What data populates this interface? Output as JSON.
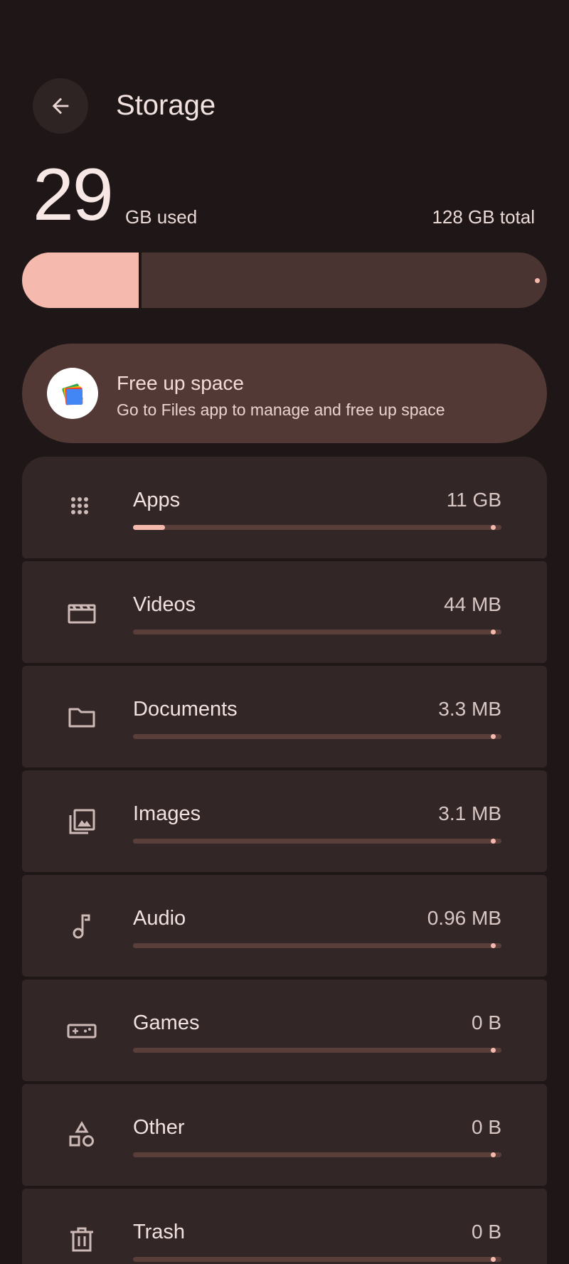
{
  "header": {
    "title": "Storage",
    "back_icon": "arrow-back-icon"
  },
  "usage": {
    "used_value": "29",
    "used_unit": "GB used",
    "total_label": "128 GB total",
    "used_fraction": 0.227
  },
  "free_up": {
    "title": "Free up space",
    "subtitle": "Go to Files app to manage and free up space",
    "icon": "files-app-icon"
  },
  "categories": [
    {
      "label": "Apps",
      "size": "11 GB",
      "icon": "apps-grid-icon",
      "fraction": 0.086
    },
    {
      "label": "Videos",
      "size": "44 MB",
      "icon": "movie-clapper-icon",
      "fraction": 0
    },
    {
      "label": "Documents",
      "size": "3.3 MB",
      "icon": "folder-icon",
      "fraction": 0
    },
    {
      "label": "Images",
      "size": "3.1 MB",
      "icon": "photo-library-icon",
      "fraction": 0
    },
    {
      "label": "Audio",
      "size": "0.96 MB",
      "icon": "music-note-icon",
      "fraction": 0
    },
    {
      "label": "Games",
      "size": "0 B",
      "icon": "gamepad-icon",
      "fraction": 0
    },
    {
      "label": "Other",
      "size": "0 B",
      "icon": "shapes-icon",
      "fraction": 0
    },
    {
      "label": "Trash",
      "size": "0 B",
      "icon": "trash-icon",
      "fraction": 0
    }
  ],
  "colors": {
    "background": "#1f1717",
    "accent": "#f6b9ad",
    "card": "#322626",
    "track": "#5a3e3a"
  }
}
